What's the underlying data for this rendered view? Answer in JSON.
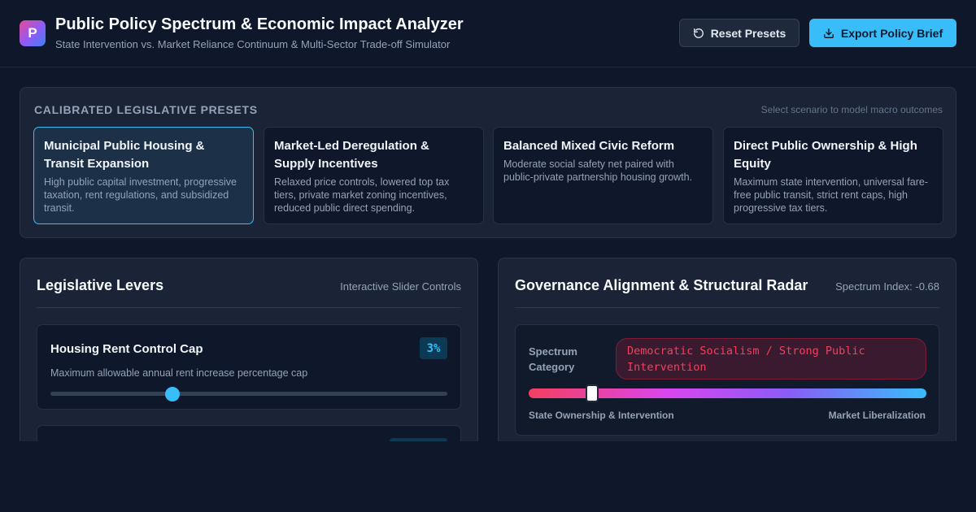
{
  "header": {
    "logo_letter": "P",
    "title": "Public Policy Spectrum & Economic Impact Analyzer",
    "subtitle": "State Intervention vs. Market Reliance Continuum & Multi-Sector Trade-off Simulator",
    "reset_label": "Reset Presets",
    "export_label": "Export Policy Brief",
    "reset_icon": "refresh-icon",
    "export_icon": "download-icon"
  },
  "presets": {
    "heading": "CALIBRATED LEGISLATIVE PRESETS",
    "hint": "Select scenario to model macro outcomes",
    "items": [
      {
        "title": "Municipal Public Housing & Transit Expansion",
        "description": "High public capital investment, progressive taxation, rent regulations, and subsidized transit.",
        "active": true
      },
      {
        "title": "Market-Led Deregulation & Supply Incentives",
        "description": "Relaxed price controls, lowered top tax tiers, private market zoning incentives, reduced public direct spending.",
        "active": false
      },
      {
        "title": "Balanced Mixed Civic Reform",
        "description": "Moderate social safety net paired with public-private partnership housing growth.",
        "active": false
      },
      {
        "title": "Direct Public Ownership & High Equity",
        "description": "Maximum state intervention, universal fare-free public transit, strict rent caps, high progressive tax tiers.",
        "active": false
      }
    ]
  },
  "levers": {
    "title": "Legislative Levers",
    "meta": "Interactive Slider Controls",
    "items": [
      {
        "title": "Housing Rent Control Cap",
        "value": "3%",
        "description": "Maximum allowable annual rent increase percentage cap",
        "slider_fraction": 0.307
      },
      {
        "title": "",
        "value": "",
        "description": "",
        "slider_fraction": 0
      }
    ]
  },
  "governance": {
    "title": "Governance Alignment & Structural Radar",
    "meta": "Spectrum Index: -0.68",
    "spectrum_index": -0.68,
    "category_label": "Spectrum Category",
    "category_value": "Democratic Socialism / Strong Public Intervention",
    "left_label": "State Ownership & Intervention",
    "right_label": "Market Liberalization",
    "colors": {
      "left": "#f43f5e",
      "mid": "#8b5cf6",
      "right": "#38bdf8"
    }
  },
  "theme": {
    "accent": "#38bdf8",
    "background": "#0f172a",
    "panel": "#1a2436"
  }
}
